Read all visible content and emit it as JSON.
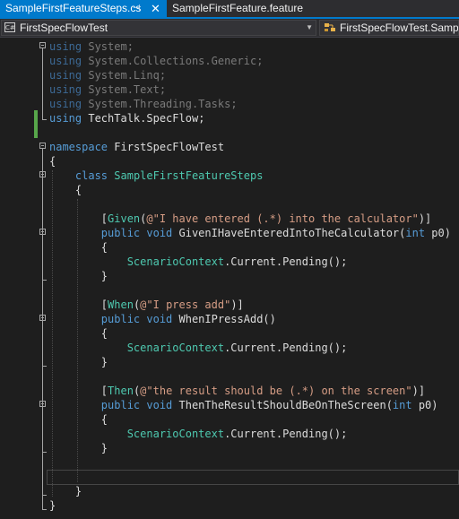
{
  "tabs": {
    "active": {
      "label": "SampleFirstFeatureSteps.cs",
      "pin": "⊣",
      "close": "✕"
    },
    "inactive": {
      "label": "SampleFirstFeature.feature"
    }
  },
  "navbar": {
    "project_icon_text": "C#",
    "project": "FirstSpecFlowTest",
    "class_path": "FirstSpecFlowTest.SampleFirstFeatureSteps"
  },
  "code": {
    "usings": [
      "System",
      "System.Collections.Generic",
      "System.Linq",
      "System.Text",
      "System.Threading.Tasks",
      "TechTalk.SpecFlow"
    ],
    "namespace_kw": "namespace",
    "namespace_name": "FirstSpecFlowTest",
    "class_kw": "class",
    "class_name": "SampleFirstFeatureSteps",
    "steps": [
      {
        "attr": "Given",
        "pattern": "@\"I have entered (.*) into the calculator\"",
        "signature_pre": "GivenIHaveEnteredIntoTheCalculator(",
        "param_type": "int",
        "param_name": " p0)",
        "body_type": "ScenarioContext",
        "body_rest": ".Current.Pending();"
      },
      {
        "attr": "When",
        "pattern": "@\"I press add\"",
        "signature_pre": "WhenIPressAdd()",
        "param_type": "",
        "param_name": "",
        "body_type": "ScenarioContext",
        "body_rest": ".Current.Pending();"
      },
      {
        "attr": "Then",
        "pattern": "@\"the result should be (.*) on the screen\"",
        "signature_pre": "ThenTheResultShouldBeOnTheScreen(",
        "param_type": "int",
        "param_name": " p0)",
        "body_type": "ScenarioContext",
        "body_rest": ".Current.Pending();"
      }
    ]
  },
  "colors": {
    "keyword": "#569cd6",
    "string": "#d69d85",
    "type": "#4ec9b0",
    "accent": "#007acc"
  }
}
